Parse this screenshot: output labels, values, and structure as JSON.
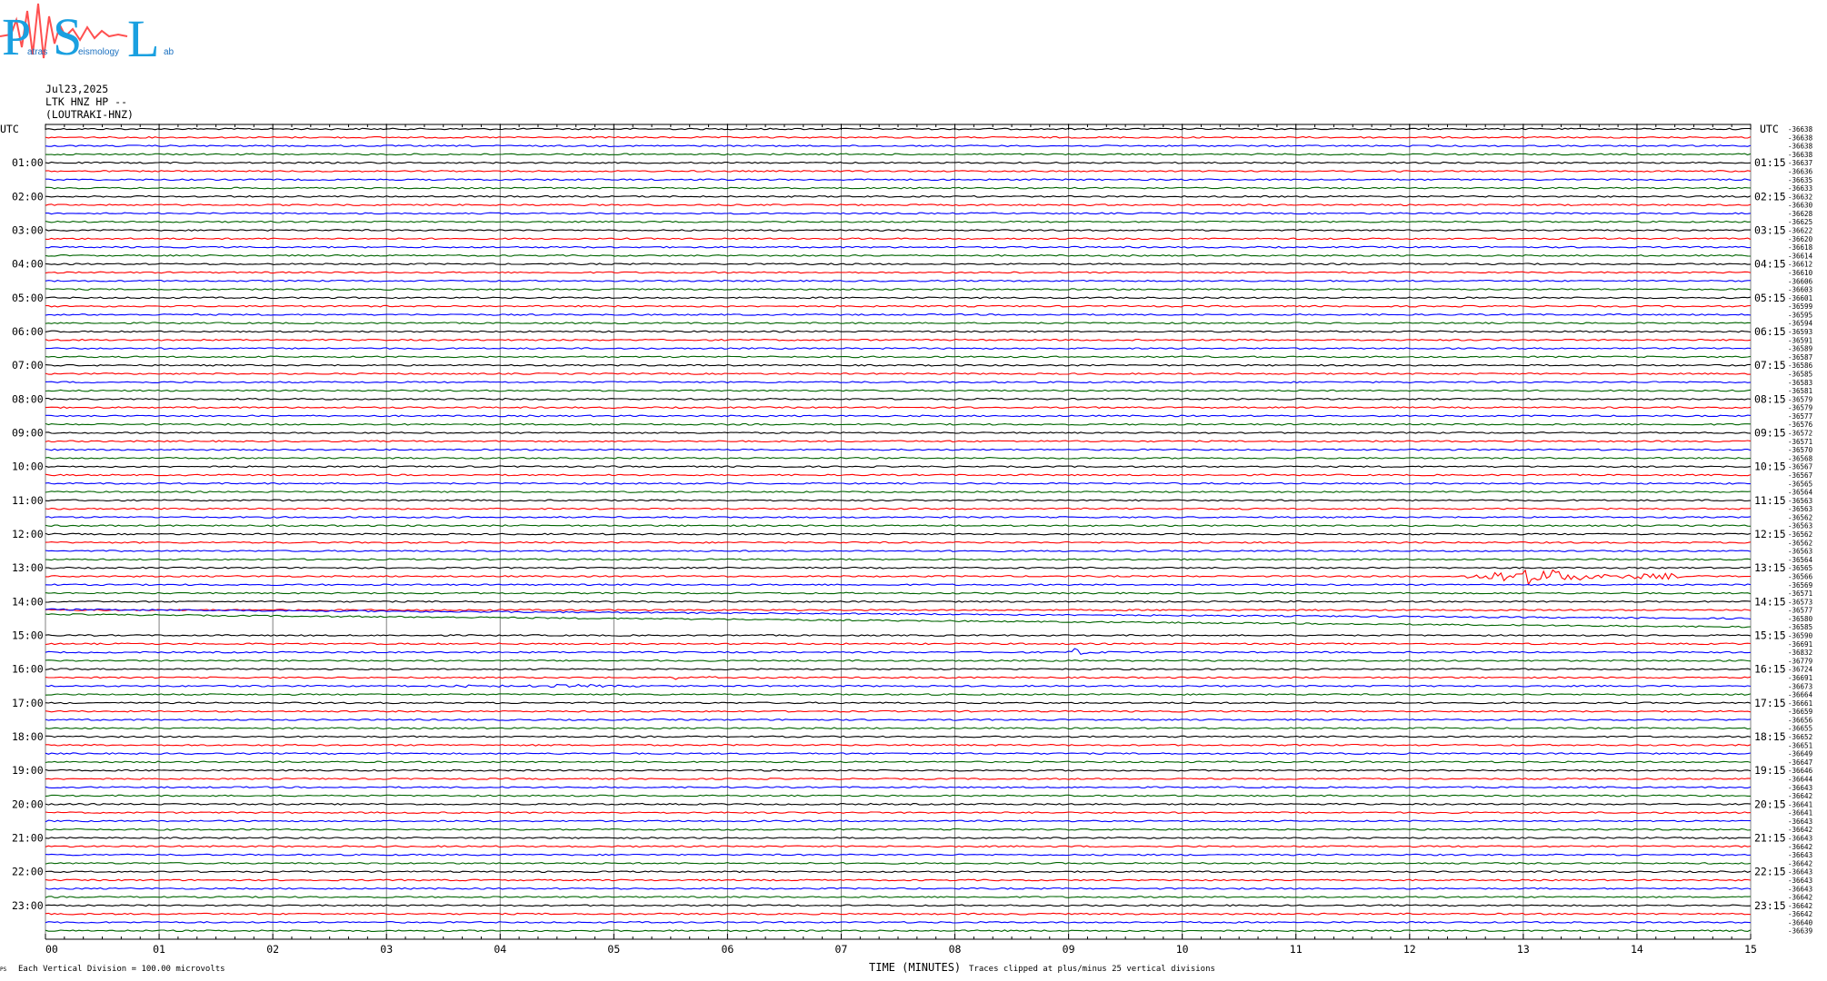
{
  "header": {
    "logo_text": "PSL",
    "logo_letters": [
      "P",
      "S",
      "L"
    ],
    "logo_subwords": [
      "atras",
      "eismology",
      "ab"
    ],
    "date": "Jul23,2025",
    "station": "LTK HNZ HP --",
    "location": "(LOUTRAKI-HNZ)"
  },
  "footer": {
    "division_note": "Each Vertical Division =  100.00 microvolts",
    "clip_note": "Traces clipped at plus/minus 25 vertical divisions",
    "corner_mark": "PS"
  },
  "colors": {
    "black": "#000000",
    "red": "#ff0000",
    "blue": "#0000ff",
    "green": "#006400",
    "grid": "#808080"
  },
  "chart_data": {
    "type": "line",
    "title": "",
    "xlabel": "TIME (MINUTES)",
    "ylabel": "UTC",
    "right_ylabel": "UTC",
    "x_ticks": [
      "00",
      "01",
      "02",
      "03",
      "04",
      "05",
      "06",
      "07",
      "08",
      "09",
      "10",
      "11",
      "12",
      "13",
      "14",
      "15"
    ],
    "xlim": [
      0,
      15
    ],
    "trace_minutes": 15,
    "trace_count": 96,
    "trace_color_cycle": [
      "black",
      "red",
      "blue",
      "green"
    ],
    "left_hour_labels": [
      "UTC",
      "01:00",
      "02:00",
      "03:00",
      "04:00",
      "05:00",
      "06:00",
      "07:00",
      "08:00",
      "09:00",
      "10:00",
      "11:00",
      "12:00",
      "13:00",
      "14:00",
      "15:00",
      "16:00",
      "17:00",
      "18:00",
      "19:00",
      "20:00",
      "21:00",
      "22:00",
      "23:00"
    ],
    "right_hour_labels": [
      "UTC",
      "01:15",
      "02:15",
      "03:15",
      "04:15",
      "05:15",
      "06:15",
      "07:15",
      "08:15",
      "09:15",
      "10:15",
      "11:15",
      "12:15",
      "13:15",
      "14:15",
      "15:15",
      "16:15",
      "17:15",
      "18:15",
      "19:15",
      "20:15",
      "21:15",
      "22:15",
      "23:15"
    ],
    "trace_offsets": [
      "-36638",
      "-36638",
      "-36638",
      "-36638",
      "-36637",
      "-36636",
      "-36635",
      "-36633",
      "-36632",
      "-36630",
      "-36628",
      "-36625",
      "-36622",
      "-36620",
      "-36618",
      "-36614",
      "-36612",
      "-36610",
      "-36606",
      "-36603",
      "-36601",
      "-36599",
      "-36595",
      "-36594",
      "-36593",
      "-36591",
      "-36589",
      "-36587",
      "-36586",
      "-36585",
      "-36583",
      "-36581",
      "-36579",
      "-36579",
      "-36577",
      "-36576",
      "-36572",
      "-36571",
      "-36570",
      "-36568",
      "-36567",
      "-36567",
      "-36565",
      "-36564",
      "-36563",
      "-36563",
      "-36562",
      "-36563",
      "-36562",
      "-36562",
      "-36563",
      "-36564",
      "-36565",
      "-36566",
      "-36569",
      "-36571",
      "-36573",
      "-36577",
      "-36580",
      "-36585",
      "-36590",
      "-36691",
      "-36832",
      "-36779",
      "-36724",
      "-36691",
      "-36673",
      "-36664",
      "-36661",
      "-36659",
      "-36656",
      "-36655",
      "-36652",
      "-36651",
      "-36649",
      "-36647",
      "-36646",
      "-36644",
      "-36643",
      "-36642",
      "-36641",
      "-36641",
      "-36643",
      "-36642",
      "-36643",
      "-36642",
      "-36643",
      "-36642",
      "-36643",
      "-36643",
      "-36643",
      "-36642",
      "-36642",
      "-36642",
      "-36640",
      "-36639"
    ],
    "events": [
      {
        "trace": 53,
        "start_min": 12.5,
        "peak_min": 13.05,
        "end_min": 14.4,
        "amplitude_div": 4.5
      },
      {
        "trace": 62,
        "start_min": 8.98,
        "peak_min": 9.05,
        "end_min": 9.4,
        "amplitude_div": 2.2
      },
      {
        "trace": 65,
        "start_min": 5.5,
        "peak_min": 5.6,
        "end_min": 6.0,
        "amplitude_div": 1.6
      },
      {
        "trace": 66,
        "start_min": 2.8,
        "peak_min": 4.8,
        "end_min": 5.6,
        "amplitude_div": 0.6
      },
      {
        "trace": 16,
        "start_min": 8.42,
        "peak_min": 8.48,
        "end_min": 8.55,
        "amplitude_div": 0.5
      }
    ]
  }
}
